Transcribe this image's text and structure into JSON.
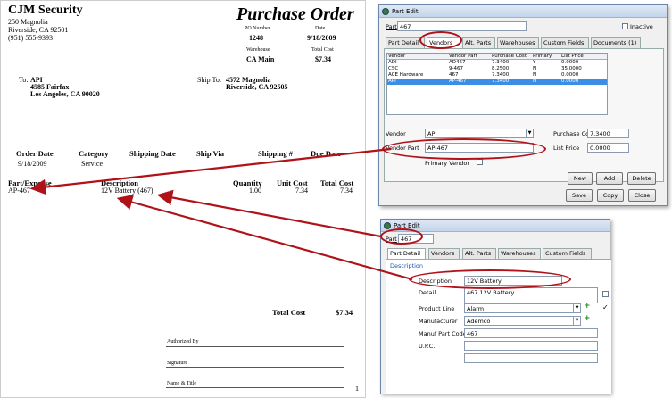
{
  "po": {
    "company": "CJM Security",
    "address1": "250 Magnolia",
    "address2": "Riverside, CA 92501",
    "phone": "(951) 555-9393",
    "title": "Purchase Order",
    "po_number_label": "PO Number",
    "po_number": "1248",
    "date_label": "Date",
    "date": "9/18/2009",
    "warehouse_label": "Warehouse",
    "warehouse": "CA Main",
    "total_cost_label": "Total Cost",
    "total_cost": "$7.34",
    "to_label": "To:",
    "to_name": "API",
    "to_addr1": "4585 Fairfax",
    "to_addr2": "Los Angeles, CA 90020",
    "shipto_label": "Ship To:",
    "shipto_addr1": "4572 Magnolia",
    "shipto_addr2": "Riverside, CA 92505",
    "headers": [
      "Order Date",
      "Category",
      "Shipping Date",
      "Ship Via",
      "Shipping #",
      "Due Date"
    ],
    "order_date": "9/18/2009",
    "category": "Service",
    "line_headers": [
      "Part/Expense",
      "Description",
      "Quantity",
      "Unit Cost",
      "Total Cost"
    ],
    "line": {
      "part": "AP-467",
      "desc": "12V Battery (467)",
      "qty": "1.00",
      "unit": "7.34",
      "total": "7.34"
    },
    "footer_total_label": "Total Cost",
    "footer_total": "$7.34",
    "authorized_by": "Authorized By",
    "signature": "Signature",
    "name_title": "Name & Title",
    "page_num": "1"
  },
  "win1": {
    "title": "Part Edit",
    "part_label": "Part",
    "part_value": "467",
    "inactive_label": "Inactive",
    "tabs": [
      "Part Detail",
      "Vendors",
      "Alt. Parts",
      "Warehouses",
      "Custom Fields",
      "Documents (1)"
    ],
    "grid_headers": [
      "Vendor",
      "Vendor Part",
      "Purchase Cost",
      "Primary",
      "List Price"
    ],
    "grid_rows": [
      [
        "ADI",
        "AD467",
        "7.3400",
        "Y",
        "0.0000"
      ],
      [
        "CSC",
        "9-467",
        "8.2500",
        "N",
        "35.0000"
      ],
      [
        "ACE Hardware",
        "467",
        "7.3400",
        "N",
        "0.0000"
      ],
      [
        "API",
        "AP-467",
        "7.3400",
        "N",
        "0.0000"
      ]
    ],
    "vendor_label": "Vendor",
    "vendor_value": "API",
    "vendor_part_label": "Vendor Part",
    "vendor_part_value": "AP-467",
    "primary_vendor_label": "Primary Vendor",
    "purchase_cost_label": "Purchase Cost",
    "purchase_cost_value": "7.3400",
    "list_price_label": "List Price",
    "list_price_value": "0.0000",
    "btn_new": "New",
    "btn_add": "Add",
    "btn_delete": "Delete",
    "btn_save": "Save",
    "btn_copy": "Copy",
    "btn_close": "Close"
  },
  "win2": {
    "title": "Part Edit",
    "part_label": "Part",
    "part_value": "467",
    "tabs": [
      "Part Detail",
      "Vendors",
      "Alt. Parts",
      "Warehouses",
      "Custom Fields"
    ],
    "section": "Description",
    "description_label": "Description",
    "description_value": "12V Battery",
    "detail_label": "Detail",
    "detail_value": "467 12V Battery",
    "product_line_label": "Product Line",
    "product_line_value": "Alarm",
    "manufacturer_label": "Manufacturer",
    "manufacturer_value": "Ademco",
    "mfr_part_label": "Manuf Part Code",
    "mfr_part_value": "467",
    "upc_label": "U.P.C."
  },
  "colors": {
    "arrow": "#b0121a",
    "selection": "#3a8ee6"
  }
}
